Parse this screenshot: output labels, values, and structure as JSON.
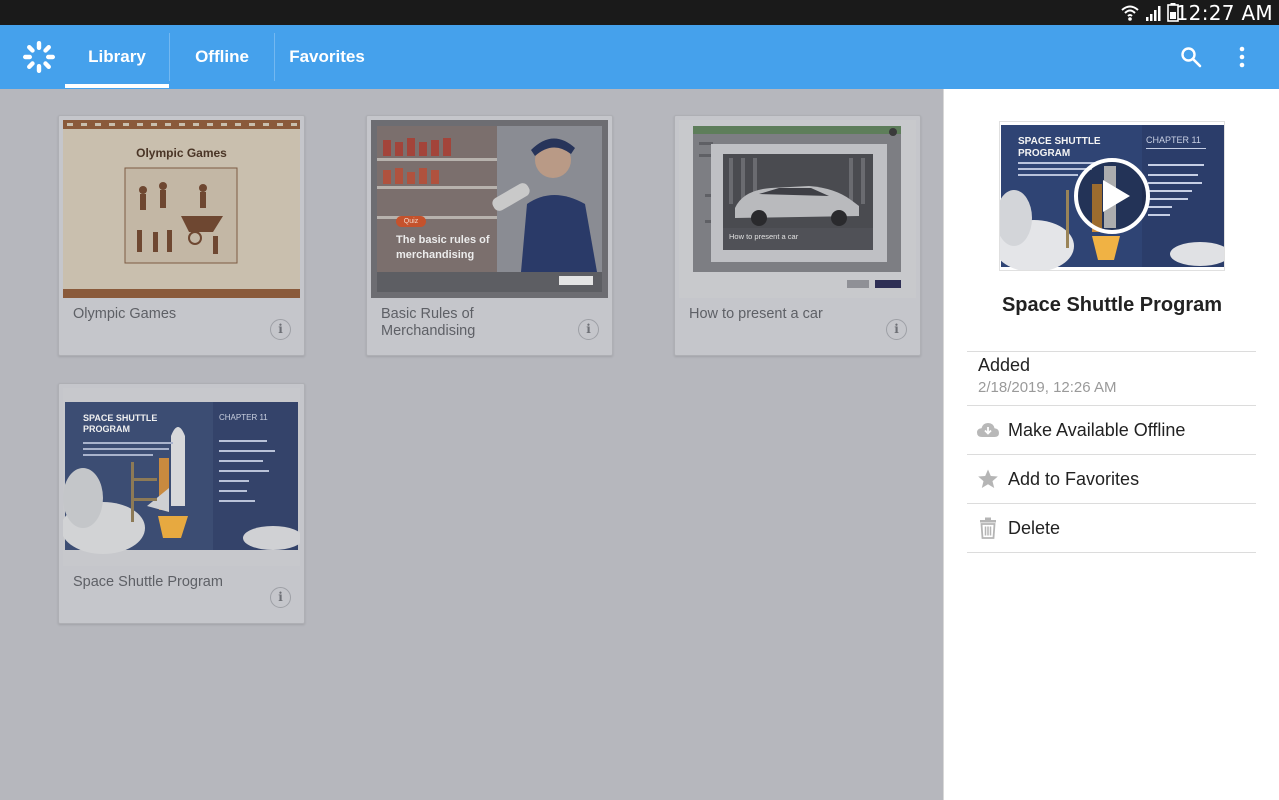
{
  "status_bar": {
    "time": "12:27 AM"
  },
  "app_bar": {
    "tabs": [
      {
        "label": "Library",
        "active": true
      },
      {
        "label": "Offline",
        "active": false
      },
      {
        "label": "Favorites",
        "active": false
      }
    ],
    "accent_color": "#45a1ec"
  },
  "library": {
    "items": [
      {
        "title": "Olympic Games",
        "thumb_heading": "Olympic Games"
      },
      {
        "title": "Basic Rules of Merchandising",
        "thumb_badge": "Quiz",
        "thumb_heading": "The basic rules of merchandising"
      },
      {
        "title": "How to present a car",
        "thumb_caption": "How to present a car"
      },
      {
        "title": "Space Shuttle Program",
        "thumb_heading": "SPACE SHUTTLE PROGRAM",
        "thumb_chapter": "CHAPTER 11"
      }
    ],
    "info_glyph": "i"
  },
  "detail": {
    "title": "Space Shuttle Program",
    "preview_heading": "SPACE SHUTTLE PROGRAM",
    "preview_chapter": "CHAPTER 11",
    "added_label": "Added",
    "added_date": "2/18/2019, 12:26 AM",
    "actions": [
      {
        "label": "Make Available Offline",
        "icon": "cloud-download-icon"
      },
      {
        "label": "Add to Favorites",
        "icon": "star-icon"
      },
      {
        "label": "Delete",
        "icon": "trash-icon"
      }
    ]
  }
}
